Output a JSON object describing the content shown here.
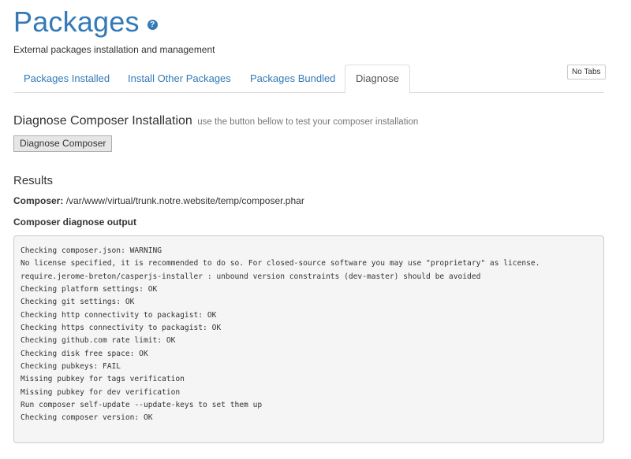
{
  "header": {
    "title": "Packages",
    "help_icon": "question-circle-icon",
    "subtitle": "External packages installation and management"
  },
  "tabs": [
    {
      "label": "Packages Installed",
      "active": false
    },
    {
      "label": "Install Other Packages",
      "active": false
    },
    {
      "label": "Packages Bundled",
      "active": false
    },
    {
      "label": "Diagnose",
      "active": true
    }
  ],
  "no_tabs_label": "No Tabs",
  "diagnose": {
    "heading": "Diagnose Composer Installation",
    "hint": "use the button bellow to test your composer installation",
    "button_label": "Diagnose Composer"
  },
  "results": {
    "heading": "Results",
    "composer_label": "Composer:",
    "composer_path": "/var/www/virtual/trunk.notre.website/temp/composer.phar",
    "output_label": "Composer diagnose output",
    "output_lines": [
      "Checking composer.json: WARNING",
      "No license specified, it is recommended to do so. For closed-source software you may use \"proprietary\" as license.",
      "require.jerome-breton/casperjs-installer : unbound version constraints (dev-master) should be avoided",
      "Checking platform settings: OK",
      "Checking git settings: OK",
      "Checking http connectivity to packagist: OK",
      "Checking https connectivity to packagist: OK",
      "Checking github.com rate limit: OK",
      "Checking disk free space: OK",
      "Checking pubkeys: FAIL",
      "Missing pubkey for tags verification",
      "Missing pubkey for dev verification",
      "Run composer self-update --update-keys to set them up",
      "Checking composer version: OK"
    ]
  },
  "colors": {
    "link": "#337ab7",
    "text": "#333333",
    "muted": "#777777",
    "output_bg": "#f5f5f5",
    "border": "#dddddd"
  }
}
